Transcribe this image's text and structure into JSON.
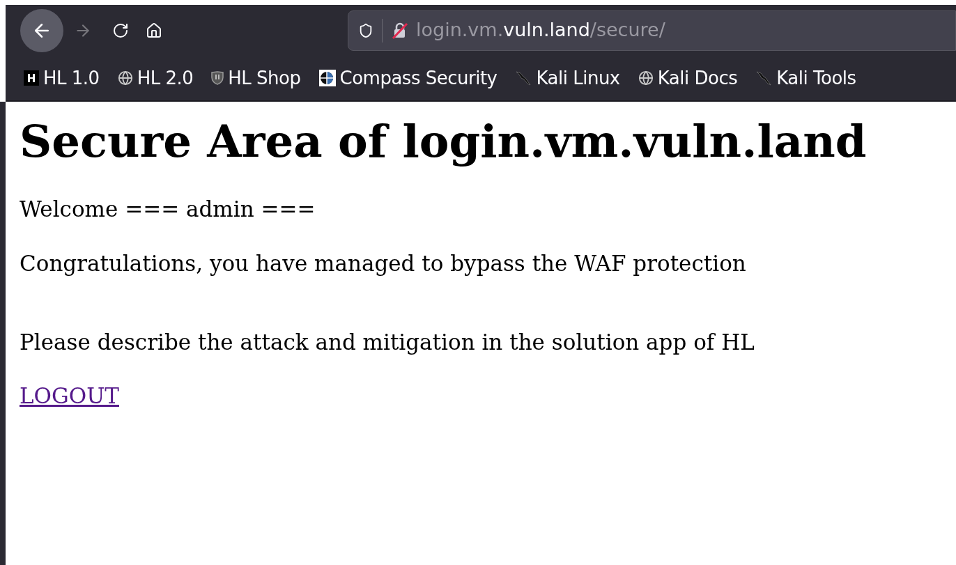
{
  "toolbar": {
    "url": {
      "prefix": "login.vm.",
      "domain": "vuln.land",
      "path": "/secure/"
    }
  },
  "bookmarks": [
    {
      "kind": "letter",
      "label": "HL 1.0"
    },
    {
      "kind": "web",
      "label": "HL 2.0"
    },
    {
      "kind": "shop",
      "label": "HL Shop"
    },
    {
      "kind": "company",
      "label": "Compass Security"
    },
    {
      "kind": "tool",
      "label": "Kali Linux"
    },
    {
      "kind": "web",
      "label": "Kali Docs"
    },
    {
      "kind": "tool",
      "label": "Kali Tools"
    }
  ],
  "page": {
    "heading": "Secure Area of login.vm.vuln.land",
    "paragraphs": [
      "Welcome === admin ===",
      "Congratulations, you have managed to bypass the WAF protection",
      "Please describe the attack and mitigation in the solution app of HL"
    ],
    "link": "LOGOUT"
  }
}
